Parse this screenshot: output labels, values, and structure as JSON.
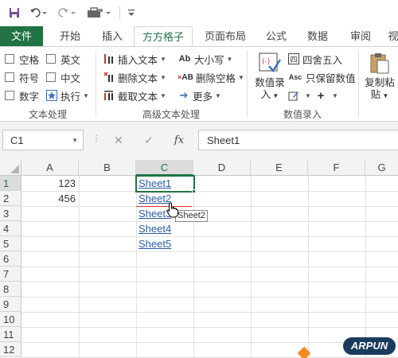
{
  "ribbon_tabs": [
    "文件",
    "开始",
    "插入",
    "方方格子",
    "页面布局",
    "公式",
    "数据",
    "审阅",
    "视"
  ],
  "groups": {
    "text_processing": {
      "label": "文本处理",
      "checkboxes": [
        "空格",
        "英文",
        "符号",
        "中文",
        "数字"
      ],
      "execute": "执行"
    },
    "advanced_text": {
      "label": "高级文本处理",
      "items": [
        "插入文本",
        "大小写",
        "删除文本",
        "删除空格",
        "截取文本",
        "更多"
      ]
    },
    "number_entry": {
      "label": "数值录入",
      "big_button": [
        "数值录",
        "入"
      ],
      "items": [
        "四舍五入",
        "只保留数值"
      ]
    },
    "clipboard": {
      "big_button": [
        "复制粘",
        "贴"
      ]
    }
  },
  "formula_bar": {
    "name_box": "C1",
    "content": "Sheet1"
  },
  "columns": [
    "A",
    "B",
    "C",
    "D",
    "E",
    "F",
    "G"
  ],
  "rows": [
    "1",
    "2",
    "3",
    "4",
    "5",
    "6",
    "7",
    "8",
    "9",
    "10",
    "11",
    "12"
  ],
  "cells": {
    "A1": "123",
    "A2": "456",
    "C1": "Sheet1",
    "C2": "Sheet2",
    "C3": "Sheet3",
    "C4": "Sheet4",
    "C5": "Sheet5"
  },
  "tooltip": "Sheet2",
  "watermark": "ARPUN",
  "colors": {
    "excel_green": "#217346",
    "link_blue": "#2f5c9f",
    "annotation_red": "#e03030"
  }
}
